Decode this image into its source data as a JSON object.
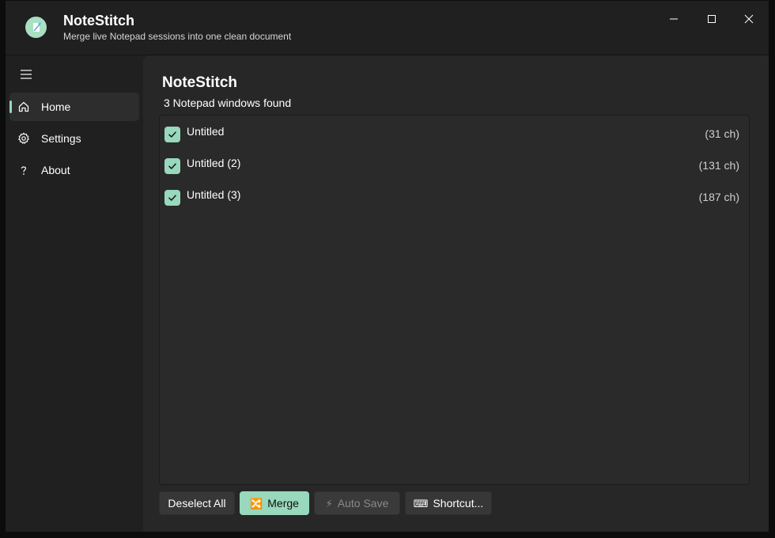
{
  "app": {
    "title": "NoteStitch",
    "subtitle": "Merge live Notepad sessions into one clean document"
  },
  "colors": {
    "accent": "#98d8bc",
    "window_bg": "#202020",
    "content_bg": "#272727"
  },
  "window_controls": {
    "icons": [
      "minimize-icon",
      "maximize-icon",
      "close-icon"
    ]
  },
  "sidebar": {
    "menu_icon": "hamburger-icon",
    "items": [
      {
        "label": "Home",
        "icon": "home-icon",
        "active": true
      },
      {
        "label": "Settings",
        "icon": "gear-icon",
        "active": false
      },
      {
        "label": "About",
        "icon": "question-icon",
        "active": false
      }
    ]
  },
  "main": {
    "title": "NoteStitch",
    "status": "3 Notepad windows found",
    "windows": [
      {
        "name": "Untitled",
        "count": "(31 ch)",
        "checked": true
      },
      {
        "name": "Untitled (2)",
        "count": "(131 ch)",
        "checked": true
      },
      {
        "name": "Untitled (3)",
        "count": "(187 ch)",
        "checked": true
      }
    ]
  },
  "actions": {
    "deselect_all": "Deselect All",
    "merge_icon": "🔀",
    "merge": "Merge",
    "auto_save_icon": "⚡",
    "auto_save": "Auto Save",
    "shortcut_icon": "⌨",
    "shortcut": "Shortcut..."
  }
}
